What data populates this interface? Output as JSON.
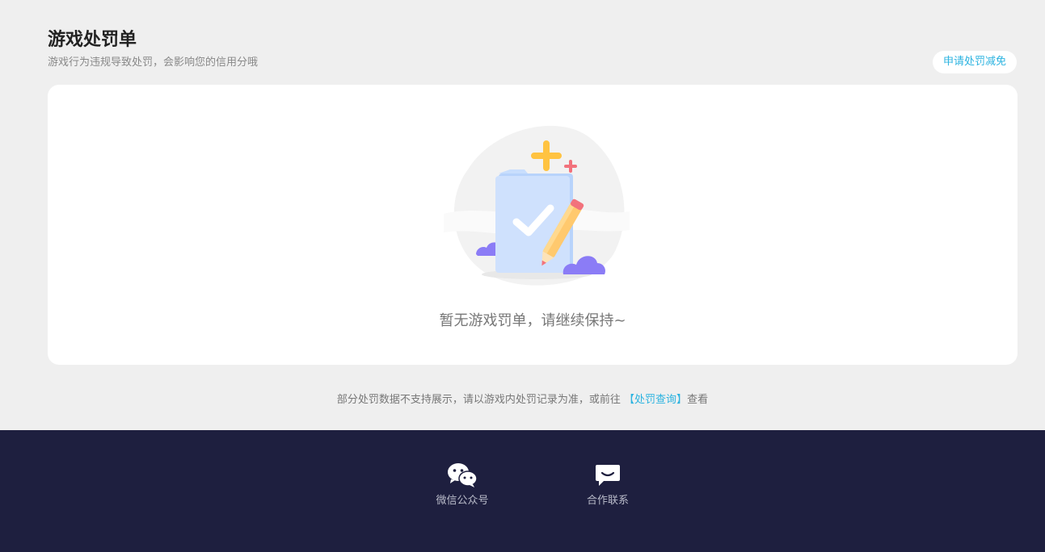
{
  "header": {
    "title": "游戏处罚单",
    "subtitle": "游戏行为违规导致处罚，会影响您的信用分哦"
  },
  "appeal_button": {
    "label": "申请处罚减免"
  },
  "empty_state": {
    "message": "暂无游戏罚单，请继续保持~"
  },
  "note": {
    "prefix": "部分处罚数据不支持展示，请以游戏内处罚记录为准，或前往 ",
    "link": "【处罚查询】",
    "suffix": "查看"
  },
  "footer": {
    "items": [
      {
        "label": "微信公众号",
        "icon": "wechat-icon"
      },
      {
        "label": "合作联系",
        "icon": "message-icon"
      }
    ]
  },
  "colors": {
    "accent": "#2bb3e0",
    "footer_bg": "#1e1f3f",
    "page_bg": "#efefef"
  }
}
